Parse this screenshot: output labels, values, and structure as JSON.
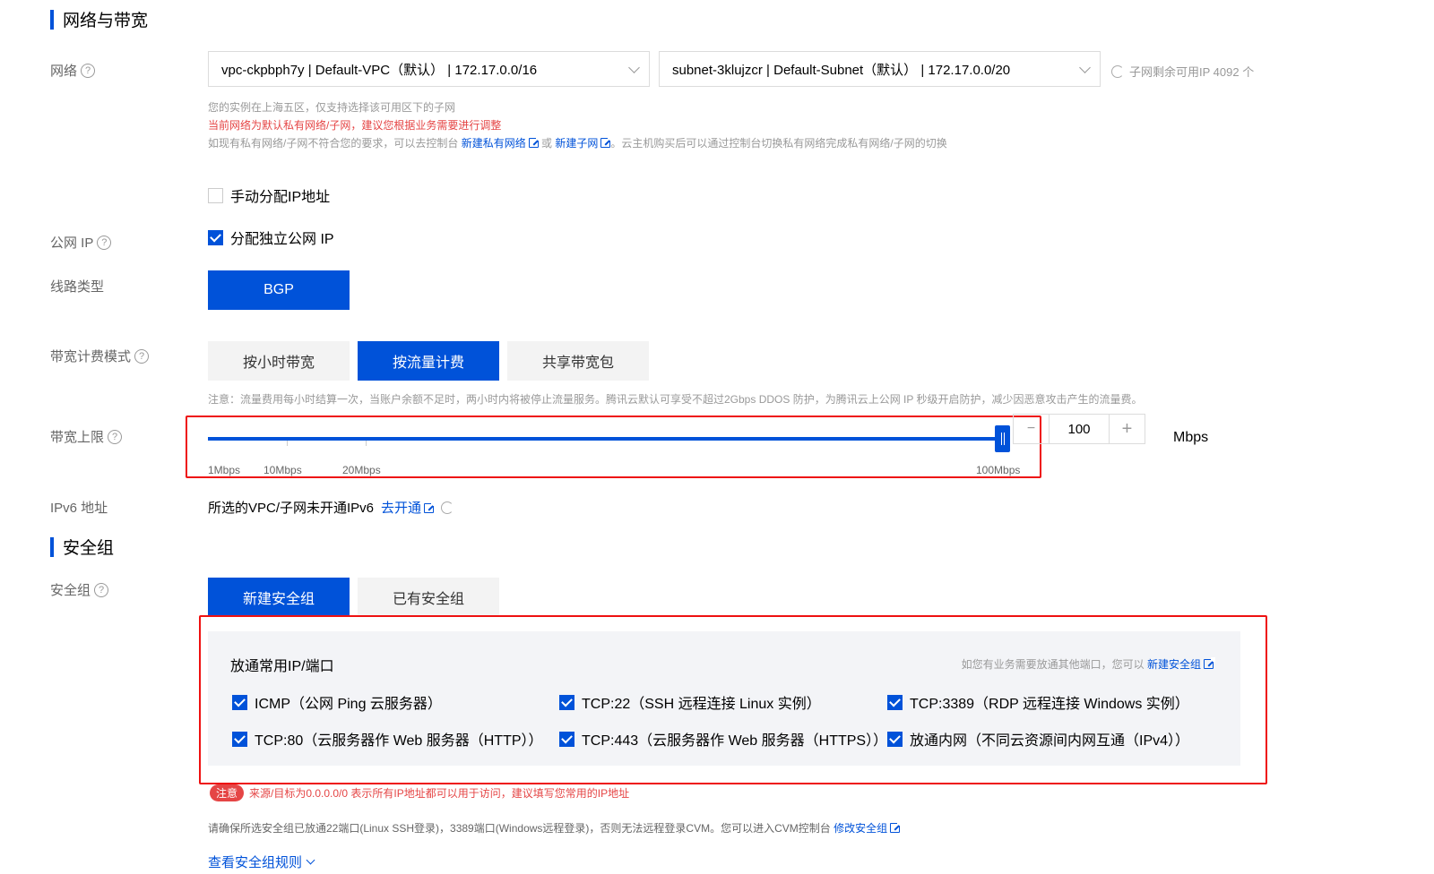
{
  "section_network": {
    "title": "网络与带宽"
  },
  "network": {
    "label": "网络",
    "vpc_value": "vpc-ckpbph7y | Default-VPC（默认） | 172.17.0.0/16",
    "subnet_value": "subnet-3klujzcr | Default-Subnet（默认） | 172.17.0.0/20",
    "remaining_ip": "子网剩余可用IP 4092 个",
    "hint1": "您的实例在上海五区，仅支持选择该可用区下的子网",
    "hint2": "当前网络为默认私有网络/子网，建议您根据业务需要进行调整",
    "hint3_prefix": "如现有私有网络/子网不符合您的要求，可以去控制台",
    "hint3_link1": "新建私有网络",
    "hint3_or": "或",
    "hint3_link2": "新建子网",
    "hint3_suffix": "。云主机购买后可以通过控制台切换私有网络完成私有网络/子网的切换",
    "manual_ip_label": "手动分配IP地址"
  },
  "public_ip": {
    "label": "公网 IP",
    "checkbox_label": "分配独立公网 IP"
  },
  "line_type": {
    "label": "线路类型",
    "option": "BGP"
  },
  "billing": {
    "label": "带宽计费模式",
    "options": [
      "按小时带宽",
      "按流量计费",
      "共享带宽包"
    ],
    "selected": "按流量计费",
    "note": "注意：流量费用每小时结算一次，当账户余额不足时，两小时内将被停止流量服务。腾讯云默认可享受不超过2Gbps DDOS 防护，为腾讯云上公网 IP 秒级开启防护，减少因恶意攻击产生的流量费。"
  },
  "bandwidth": {
    "label": "带宽上限",
    "ticks": [
      "1Mbps",
      "10Mbps",
      "20Mbps",
      "100Mbps"
    ],
    "value": "100",
    "fraction": 1.0,
    "unit": "Mbps",
    "minus": "−",
    "plus": "+"
  },
  "ipv6": {
    "label": "IPv6 地址",
    "text": "所选的VPC/子网未开通IPv6",
    "link": "去开通"
  },
  "section_sg": {
    "title": "安全组"
  },
  "security_group": {
    "label": "安全组",
    "tabs": [
      "新建安全组",
      "已有安全组"
    ],
    "panel_title": "放通常用IP/端口",
    "panel_hint": "如您有业务需要放通其他端口，您可以",
    "panel_hint_link": "新建安全组",
    "rules": [
      "ICMP（公网 Ping 云服务器）",
      "TCP:22（SSH 远程连接 Linux 实例）",
      "TCP:3389（RDP 远程连接 Windows 实例）",
      "TCP:80（云服务器作 Web 服务器（HTTP））",
      "TCP:443（云服务器作 Web 服务器（HTTPS））",
      "放通内网（不同云资源间内网互通（IPv4））"
    ],
    "notice_badge": "注意",
    "notice_text": "来源/目标为0.0.0.0/0 表示所有IP地址都可以用于访问，建议填写您常用的IP地址",
    "ensure_text": "请确保所选安全组已放通22端口(Linux SSH登录)，3389端口(Windows远程登录)，否则无法远程登录CVM。您可以进入CVM控制台",
    "ensure_link": "修改安全组",
    "view_rules": "查看安全组规则"
  },
  "colors": {
    "primary": "#0052d9",
    "highlight_box": "#e11111",
    "danger": "#e54545"
  }
}
